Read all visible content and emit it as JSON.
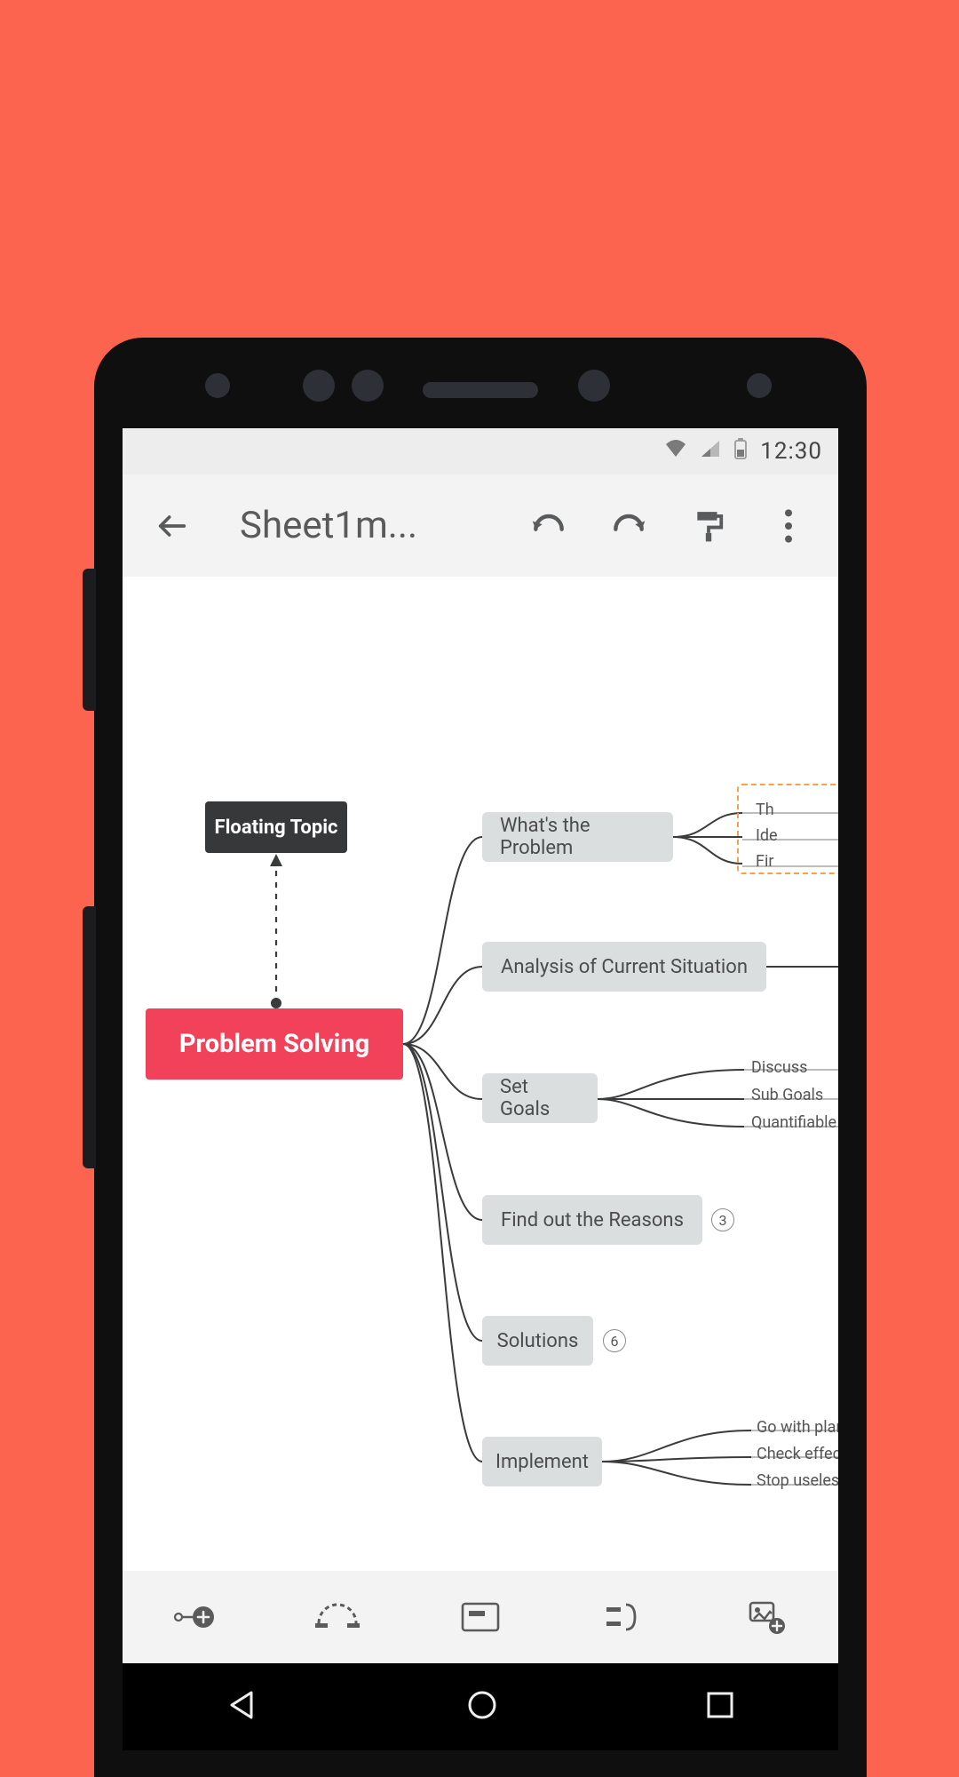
{
  "statusbar": {
    "time": "12:30"
  },
  "appbar": {
    "title": "Sheet1m..."
  },
  "mindmap": {
    "floating_topic": "Floating Topic",
    "root": "Problem Solving",
    "children": {
      "c1": {
        "label": "What's the Problem",
        "leaves": [
          "Th",
          "Ide",
          "Fir"
        ]
      },
      "c2": {
        "label": "Analysis of Current Situation"
      },
      "c3": {
        "label": "Set Goals",
        "leaves": [
          "Discuss",
          "Sub Goals",
          "Quantifiable targe"
        ]
      },
      "c4": {
        "label": "Find out the Reasons",
        "count": "3"
      },
      "c5": {
        "label": "Solutions",
        "count": "6"
      },
      "c6": {
        "label": "Implement",
        "leaves": [
          "Go with plans",
          "Check effect of",
          "Stop useless so"
        ]
      }
    }
  }
}
